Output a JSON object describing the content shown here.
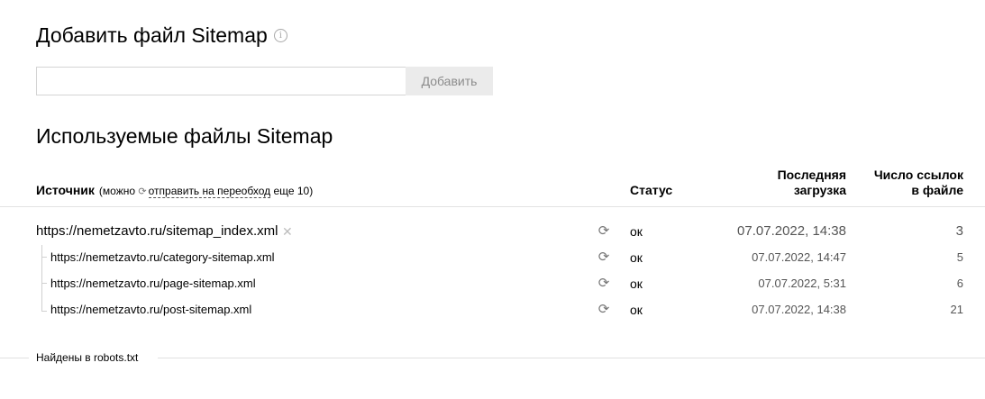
{
  "add_section": {
    "title": "Добавить файл Sitemap",
    "input_value": "",
    "input_placeholder": "",
    "button_label": "Добавить"
  },
  "used_section": {
    "title": "Используемые файлы Sitemap"
  },
  "table": {
    "columns": {
      "source": "Источник",
      "source_note_prefix": "(можно",
      "source_note_link": "отправить на переобход",
      "source_note_suffix": "еще 10)",
      "status": "Статус",
      "last_load": "Последняя загрузка",
      "link_count": "Число ссылок в файле"
    },
    "rows": [
      {
        "url": "https://nemetzavto.ru/sitemap_index.xml",
        "status": "ок",
        "date": "07.07.2022, 14:38",
        "count": "3"
      },
      {
        "url": "https://nemetzavto.ru/category-sitemap.xml",
        "status": "ок",
        "date": "07.07.2022, 14:47",
        "count": "5"
      },
      {
        "url": "https://nemetzavto.ru/page-sitemap.xml",
        "status": "ок",
        "date": "07.07.2022, 5:31",
        "count": "6"
      },
      {
        "url": "https://nemetzavto.ru/post-sitemap.xml",
        "status": "ок",
        "date": "07.07.2022, 14:38",
        "count": "21"
      }
    ]
  },
  "robots_section": {
    "label": "Найдены в robots.txt"
  },
  "icons": {
    "info": "info-icon",
    "refresh": "refresh-icon",
    "close": "close-icon"
  },
  "colors": {
    "button_bg": "#ebebeb",
    "button_text": "#8c8c8c",
    "muted_text": "#555555",
    "divider": "#e3e3e3"
  }
}
